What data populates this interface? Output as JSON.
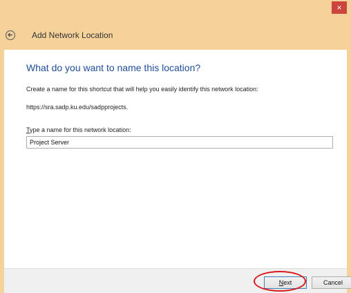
{
  "window": {
    "close_symbol": "×",
    "header_title": "Add Network Location"
  },
  "content": {
    "heading": "What do you want to name this location?",
    "description": "Create a name for this shortcut that will help you easily identify this network location:",
    "url": "https://sra.sadp.ku.edu/sadpprojects.",
    "field_label_mnemonic": "T",
    "field_label_rest": "ype a name for this network location:",
    "name_value": "Project Server"
  },
  "footer": {
    "next_mnemonic": "N",
    "next_rest": "ext",
    "cancel_label": "Cancel"
  },
  "colors": {
    "chrome": "#f4d29a",
    "heading": "#1e4c9a",
    "close": "#c9453e",
    "annotation_ring": "#d9181c"
  },
  "icons": {
    "back": "back-arrow-icon",
    "close": "close-icon"
  }
}
